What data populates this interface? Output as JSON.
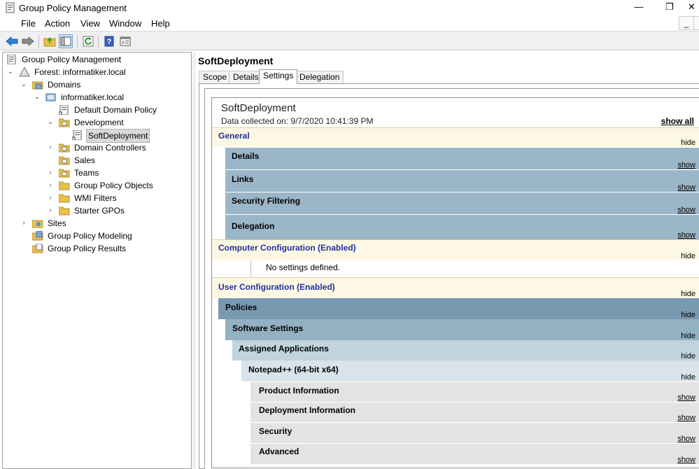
{
  "window": {
    "title": "Group Policy Management",
    "minimize": "—",
    "restore": "❐",
    "close": "✕"
  },
  "menu": {
    "items": [
      "File",
      "Action",
      "View",
      "Window",
      "Help"
    ],
    "mdi_minimize": "_",
    "mdi_restore": "▫"
  },
  "toolbar": {
    "buttons": [
      "back-icon",
      "forward-icon",
      "up-folder-icon",
      "show-hide-tree-icon",
      "refresh-icon",
      "help-icon",
      "properties-icon"
    ]
  },
  "tree": {
    "root": "Group Policy Management",
    "forest": "Forest: informatiker.local",
    "domains": "Domains",
    "domain": "informatiker.local",
    "default_policy": "Default Domain Policy",
    "development": "Development",
    "softdeployment": "SoftDeployment",
    "domain_controllers": "Domain Controllers",
    "sales": "Sales",
    "teams": "Teams",
    "gpo_objects": "Group Policy Objects",
    "wmi_filters": "WMI Filters",
    "starter_gpos": "Starter GPOs",
    "sites": "Sites",
    "modeling": "Group Policy Modeling",
    "results": "Group Policy Results"
  },
  "right": {
    "title": "SoftDeployment",
    "tabs": [
      "Scope",
      "Details",
      "Settings",
      "Delegation"
    ],
    "active_tab": "Settings"
  },
  "report": {
    "title": "SoftDeployment",
    "collected": "Data collected on: 9/7/2020 10:41:39 PM",
    "show_all": "show all",
    "general": "General",
    "details": "Details",
    "links": "Links",
    "security_filtering": "Security Filtering",
    "delegation": "Delegation",
    "computer_config": "Computer Configuration (Enabled)",
    "no_settings": "No settings defined.",
    "user_config": "User Configuration (Enabled)",
    "policies": "Policies",
    "software_settings": "Software Settings",
    "assigned_apps": "Assigned Applications",
    "notepad": "Notepad++ (64-bit x64)",
    "product_info": "Product Information",
    "deployment_info": "Deployment Information",
    "security": "Security",
    "advanced": "Advanced",
    "hide": "hide",
    "show": "show"
  }
}
